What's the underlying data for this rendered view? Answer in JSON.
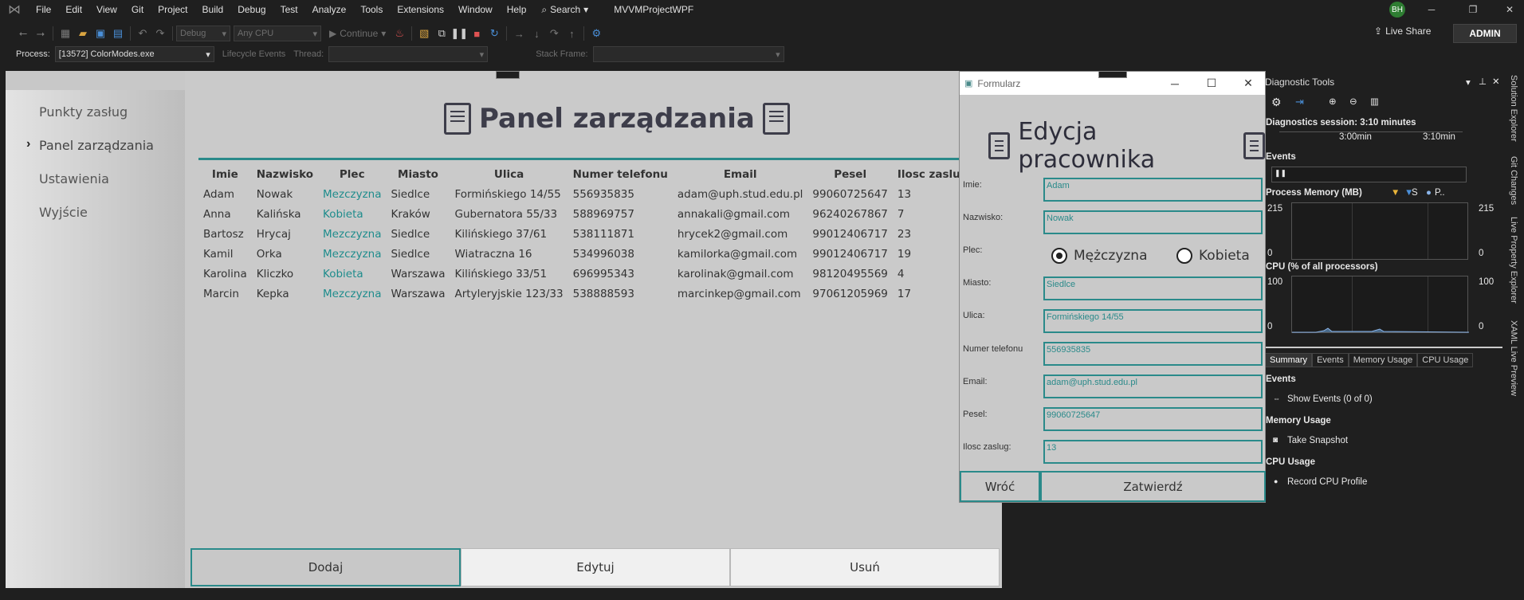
{
  "vs": {
    "menu": [
      "File",
      "Edit",
      "View",
      "Git",
      "Project",
      "Build",
      "Debug",
      "Test",
      "Analyze",
      "Tools",
      "Extensions",
      "Window",
      "Help"
    ],
    "search_label": "Search",
    "project_title": "MVVMProjectWPF",
    "user_initials": "BH",
    "live_share": "Live Share",
    "admin": "ADMIN",
    "config": "Debug",
    "platform": "Any CPU",
    "continue": "Continue",
    "process_label": "Process:",
    "process_value": "[13572] ColorModes.exe",
    "lifecycle": "Lifecycle Events",
    "thread_label": "Thread:",
    "stack_label": "Stack Frame:"
  },
  "app": {
    "nav": [
      "Punkty zasług",
      "Panel zarządzania",
      "Ustawienia",
      "Wyjście"
    ],
    "panel_title": "Panel zarządzania",
    "columns": [
      "Imie",
      "Nazwisko",
      "Plec",
      "Miasto",
      "Ulica",
      "Numer telefonu",
      "Email",
      "Pesel",
      "Ilosc zaslug"
    ],
    "rows": [
      [
        "Adam",
        "Nowak",
        "Mezczyzna",
        "Siedlce",
        "Formińskiego 14/55",
        "556935835",
        "adam@uph.stud.edu.pl",
        "99060725647",
        "13"
      ],
      [
        "Anna",
        "Kalińska",
        "Kobieta",
        "Kraków",
        "Gubernatora 55/33",
        "588969757",
        "annakali@gmail.com",
        "96240267867",
        "7"
      ],
      [
        "Bartosz",
        "Hrycaj",
        "Mezczyzna",
        "Siedlce",
        "Kilińskiego 37/61",
        "538111871",
        "hrycek2@gmail.com",
        "99012406717",
        "23"
      ],
      [
        "Kamil",
        "Orka",
        "Mezczyzna",
        "Siedlce",
        "Wiatraczna 16",
        "534996038",
        "kamilorka@gmail.com",
        "99012406717",
        "19"
      ],
      [
        "Karolina",
        "Kliczko",
        "Kobieta",
        "Warszawa",
        "Kilińskiego 33/51",
        "696995343",
        "karolinak@gmail.com",
        "98120495569",
        "4"
      ],
      [
        "Marcin",
        "Kepka",
        "Mezczyzna",
        "Warszawa",
        "Artyleryjskie 123/33",
        "538888593",
        "marcinkep@gmail.com",
        "97061205969",
        "17"
      ]
    ],
    "buttons": [
      "Dodaj",
      "Edytuj",
      "Usuń"
    ]
  },
  "form": {
    "window_title": "Formularz",
    "heading": "Edycja pracownika",
    "labels": {
      "imie": "Imie:",
      "nazwisko": "Nazwisko:",
      "plec": "Plec:",
      "miasto": "Miasto:",
      "ulica": "Ulica:",
      "telefon": "Numer telefonu",
      "email": "Email:",
      "pesel": "Pesel:",
      "zaslugi": "Ilosc zaslug:"
    },
    "values": {
      "imie": "Adam",
      "nazwisko": "Nowak",
      "miasto": "Siedlce",
      "ulica": "Formińskiego 14/55",
      "telefon": "556935835",
      "email": "adam@uph.stud.edu.pl",
      "pesel": "99060725647",
      "zaslugi": "13"
    },
    "radio_male": "Mężczyzna",
    "radio_female": "Kobieta",
    "back": "Wróć",
    "submit": "Zatwierdź"
  },
  "diag": {
    "title": "Diagnostic Tools",
    "session": "Diagnostics session: 3:10 minutes",
    "t1": "3:00min",
    "t2": "3:10min",
    "events": "Events",
    "process_memory": "Process Memory (MB)",
    "mem_legend_s": "S",
    "mem_legend_p": "P..",
    "mem_max": "215",
    "mem_min": "0",
    "cpu": "CPU (% of all processors)",
    "cpu_max": "100",
    "cpu_min": "0",
    "tabs": [
      "Summary",
      "Events",
      "Memory Usage",
      "CPU Usage"
    ],
    "sec_events": "Events",
    "show_events": "Show Events (0 of 0)",
    "sec_memory": "Memory Usage",
    "take_snapshot": "Take Snapshot",
    "sec_cpu": "CPU Usage",
    "record_cpu": "Record CPU Profile"
  },
  "side_tabs": [
    "Solution Explorer",
    "Git Changes",
    "Live Property Explorer",
    "XAML Live Preview"
  ]
}
